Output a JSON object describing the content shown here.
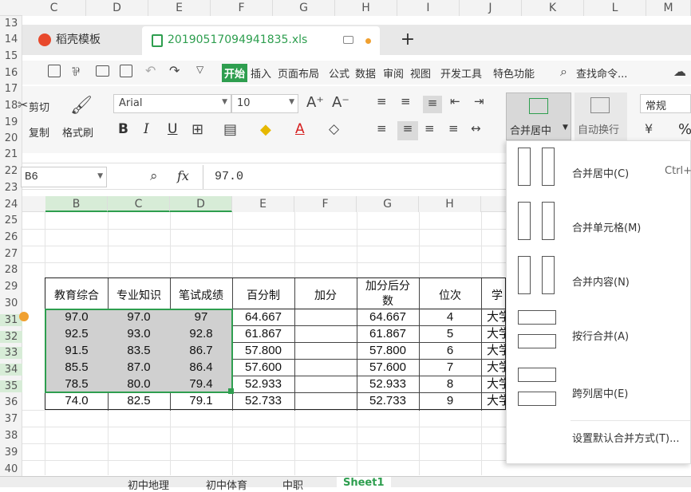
{
  "columns_top": [
    "C",
    "D",
    "E",
    "F",
    "G",
    "H",
    "I",
    "J",
    "K",
    "L",
    "M"
  ],
  "rows": [
    "13",
    "14",
    "15",
    "16",
    "17",
    "18",
    "19",
    "20",
    "21",
    "22",
    "23",
    "24",
    "25",
    "26",
    "27",
    "28",
    "29",
    "30",
    "31",
    "32",
    "33",
    "34",
    "35",
    "36",
    "37",
    "38",
    "39",
    "40"
  ],
  "tabs": {
    "template_tab": "稻壳模板",
    "file_tab": "20190517094941835.xls",
    "add": "+"
  },
  "menu": {
    "start": "开始",
    "insert": "插入",
    "page_layout": "页面布局",
    "formula": "公式",
    "data": "数据",
    "review": "审阅",
    "view": "视图",
    "dev_tools": "开发工具",
    "special": "特色功能",
    "search": "查找命令..."
  },
  "ribbon": {
    "cut": "剪切",
    "copy": "复制",
    "format_painter": "格式刷",
    "font_name": "Arial",
    "font_size": "10",
    "bold": "B",
    "italic": "I",
    "underline": "U",
    "merge_center": "合并居中",
    "wrap_text": "自动换行",
    "number_format": "常规",
    "percent": "%"
  },
  "formula_bar": {
    "name_box": "B6",
    "fx": "fx",
    "value": "97.0"
  },
  "grid_columns": [
    "B",
    "C",
    "D",
    "E",
    "F",
    "G",
    "H"
  ],
  "table": {
    "headers": [
      "教育综合",
      "专业知识",
      "笔试成绩",
      "百分制",
      "加分",
      "加分后分数",
      "位次",
      "学"
    ],
    "rows": [
      [
        "97.0",
        "97.0",
        "97",
        "64.667",
        "",
        "64.667",
        "4",
        "大学"
      ],
      [
        "92.5",
        "93.0",
        "92.8",
        "61.867",
        "",
        "61.867",
        "5",
        "大学"
      ],
      [
        "91.5",
        "83.5",
        "86.7",
        "57.800",
        "",
        "57.800",
        "6",
        "大学"
      ],
      [
        "85.5",
        "87.0",
        "86.4",
        "57.600",
        "",
        "57.600",
        "7",
        "大学"
      ],
      [
        "78.5",
        "80.0",
        "79.4",
        "52.933",
        "",
        "52.933",
        "8",
        "大学"
      ],
      [
        "74.0",
        "82.5",
        "79.1",
        "52.733",
        "",
        "52.733",
        "9",
        "大学"
      ]
    ]
  },
  "merge_menu": {
    "items": [
      {
        "label": "合并居中(C)",
        "shortcut": "Ctrl+"
      },
      {
        "label": "合并单元格(M)",
        "shortcut": ""
      },
      {
        "label": "合并内容(N)",
        "shortcut": ""
      },
      {
        "label": "按行合并(A)",
        "shortcut": ""
      },
      {
        "label": "跨列居中(E)",
        "shortcut": ""
      }
    ],
    "settings": "设置默认合并方式(T)..."
  },
  "sheet_tabs": [
    "初中地理",
    "初中体育",
    "中职",
    "Sheet1"
  ],
  "colors": {
    "accent_green": "#2e9e4f",
    "selected_fill": "#d0d0d0",
    "grid_header_green": "#d7ecd7"
  }
}
